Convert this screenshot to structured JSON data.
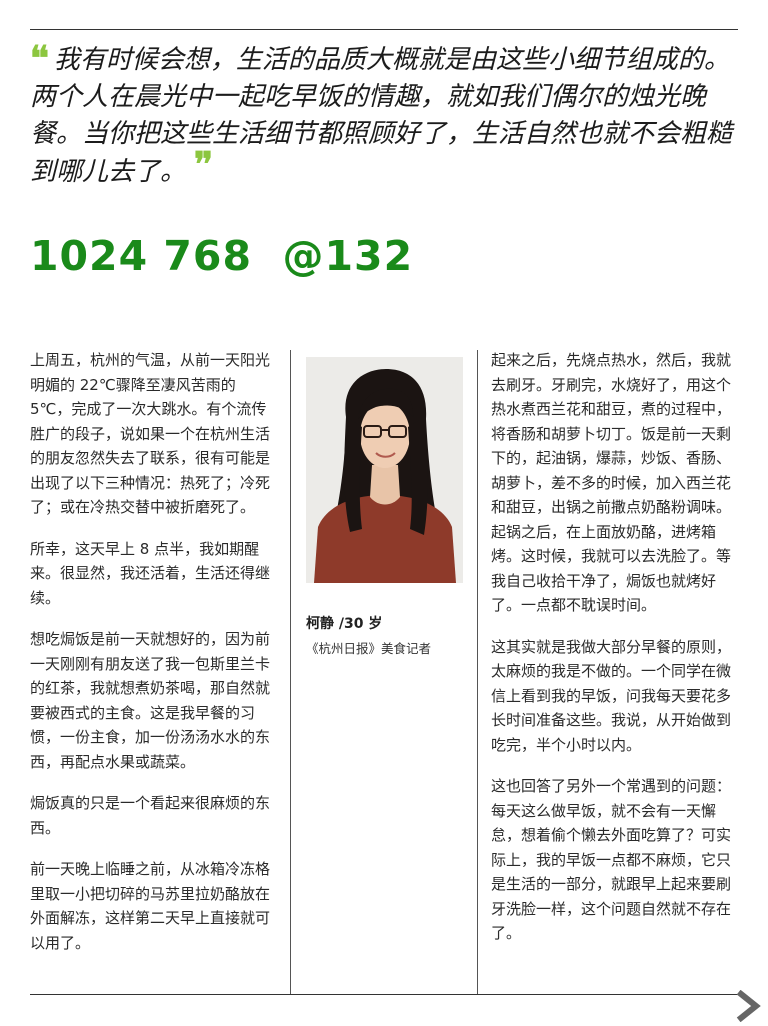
{
  "quote": {
    "open_mark": "❛❛",
    "text": "我有时候会想，生活的品质大概就是由这些小细节组成的。两个人在晨光中一起吃早饭的情趣，就如我们偶尔的烛光晚餐。当你把这些生活细节都照顾好了，生活自然也就不会粗糙到哪儿去了。",
    "close_mark": "❜❜"
  },
  "headline": "1024 768  @132",
  "left_column": [
    "上周五，杭州的气温，从前一天阳光明媚的 22℃骤降至凄风苦雨的 5℃，完成了一次大跳水。有个流传胜广的段子，说如果一个在杭州生活的朋友忽然失去了联系，很有可能是出现了以下三种情况：热死了；冷死了；或在冷热交替中被折磨死了。",
    "所幸，这天早上 8 点半，我如期醒来。很显然，我还活着，生活还得继续。",
    "想吃焗饭是前一天就想好的，因为前一天刚刚有朋友送了我一包斯里兰卡的红茶，我就想煮奶茶喝，那自然就要被西式的主食。这是我早餐的习惯，一份主食，加一份汤汤水水的东西，再配点水果或蔬菜。",
    "焗饭真的只是一个看起来很麻烦的东西。",
    "前一天晚上临睡之前，从冰箱冷冻格里取一小把切碎的马苏里拉奶酪放在外面解冻，这样第二天早上直接就可以用了。"
  ],
  "caption": {
    "name": "柯静 /30 岁",
    "role": "《杭州日报》美食记者"
  },
  "right_column": [
    "起来之后，先烧点热水，然后，我就去刷牙。牙刷完，水烧好了，用这个热水煮西兰花和甜豆，煮的过程中，将香肠和胡萝卜切丁。饭是前一天剩下的，起油锅，爆蒜，炒饭、香肠、胡萝卜，差不多的时候，加入西兰花和甜豆，出锅之前撒点奶酪粉调味。起锅之后，在上面放奶酪，进烤箱烤。这时候，我就可以去洗脸了。等我自己收拾干净了，焗饭也就烤好了。一点都不耽误时间。",
    "这其实就是我做大部分早餐的原则，太麻烦的我是不做的。一个同学在微信上看到我的早饭，问我每天要花多长时间准备这些。我说，从开始做到吃完，半个小时以内。",
    "这也回答了另外一个常遇到的问题：每天这么做早饭，就不会有一天懈怠，想着偷个懒去外面吃算了？可实际上，我的早饭一点都不麻烦，它只是生活的一部分，就跟早上起来要刷牙洗脸一样，这个问题自然就不存在了。"
  ],
  "colors": {
    "accent_green": "#8cc63f",
    "headline_green": "#1a8a1a",
    "sweater": "#8e3a2a"
  },
  "icons": {
    "next_page": "chevron-right-icon"
  }
}
